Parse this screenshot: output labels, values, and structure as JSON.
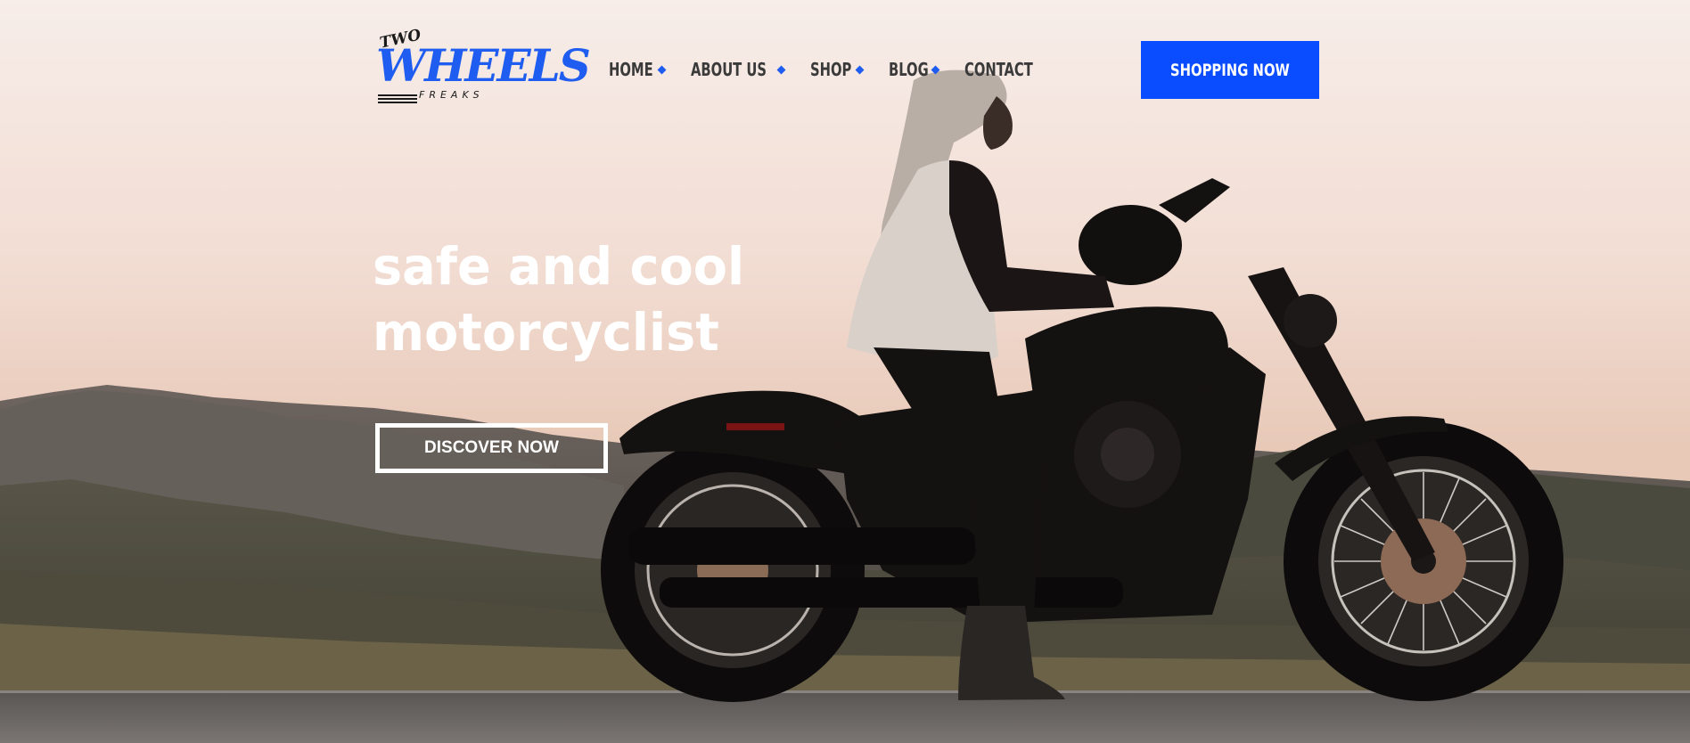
{
  "header": {
    "logo": {
      "top_text": "TWO",
      "main_text": "WHEELS",
      "sub_text": "FREAKS"
    },
    "nav": [
      "HOME",
      "ABOUT US",
      "SHOP",
      "BLOG",
      "CONTACT"
    ],
    "cta_label": "SHOPPING NOW"
  },
  "hero": {
    "headline_line1": "safe and cool",
    "headline_line2": "motorcyclist",
    "button_label": "DISCOVER NOW"
  },
  "colors": {
    "accent": "#0a4cff",
    "logo": "#1f5cf0",
    "headline": "#ffffff"
  }
}
